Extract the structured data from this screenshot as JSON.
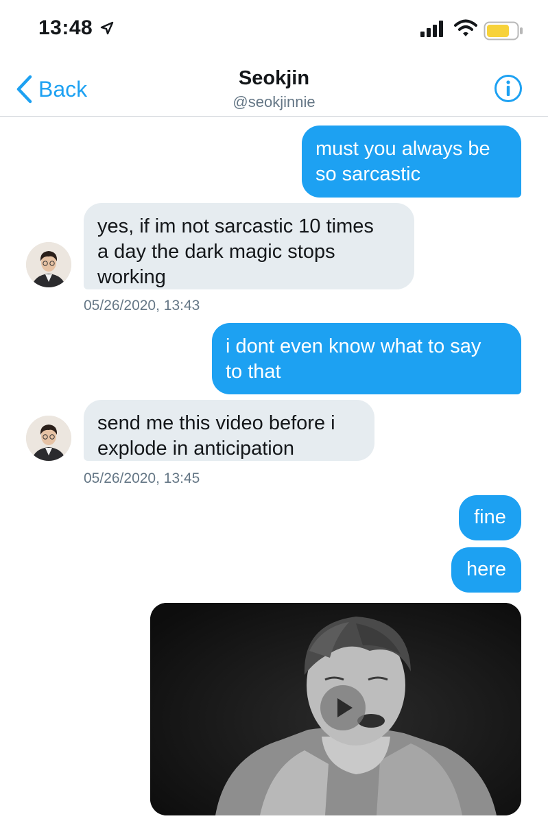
{
  "status_bar": {
    "time": "13:48",
    "icons": [
      "location-arrow-icon",
      "cellular-signal-icon",
      "wifi-icon",
      "battery-icon"
    ],
    "battery_color": "#f7d23a"
  },
  "nav": {
    "back_label": "Back",
    "title": "Seokjin",
    "handle": "@seokjinnie",
    "accent_color": "#1da1f2"
  },
  "messages": [
    {
      "direction": "outgoing",
      "lines": [
        "must you always be",
        "so sarcastic"
      ]
    },
    {
      "direction": "incoming",
      "lines": [
        "yes, if im not sarcastic 10 times",
        "a day the dark magic stops",
        "working"
      ],
      "timestamp": "05/26/2020, 13:43"
    },
    {
      "direction": "outgoing",
      "lines": [
        "i dont even know what to say",
        "to that"
      ]
    },
    {
      "direction": "incoming",
      "lines": [
        "send me this video before i",
        "explode in anticipation"
      ],
      "timestamp": "05/26/2020, 13:45"
    },
    {
      "direction": "outgoing",
      "lines": [
        "fine"
      ]
    },
    {
      "direction": "outgoing",
      "lines": [
        "here"
      ]
    },
    {
      "direction": "outgoing",
      "type": "video",
      "icon": "play-icon"
    }
  ],
  "colors": {
    "outgoing_bubble": "#1da1f2",
    "incoming_bubble": "#e6ecf0",
    "timestamp": "#657786"
  }
}
